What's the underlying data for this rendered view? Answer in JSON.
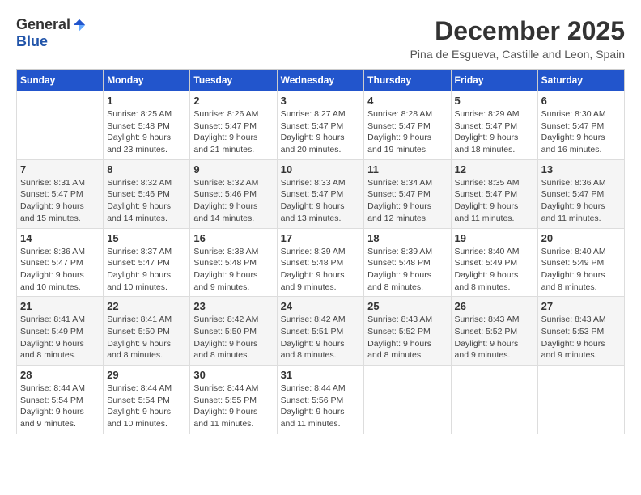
{
  "logo": {
    "general": "General",
    "blue": "Blue"
  },
  "title": "December 2025",
  "subtitle": "Pina de Esgueva, Castille and Leon, Spain",
  "days_of_week": [
    "Sunday",
    "Monday",
    "Tuesday",
    "Wednesday",
    "Thursday",
    "Friday",
    "Saturday"
  ],
  "weeks": [
    [
      {
        "day": "",
        "info": ""
      },
      {
        "day": "1",
        "info": "Sunrise: 8:25 AM\nSunset: 5:48 PM\nDaylight: 9 hours\nand 23 minutes."
      },
      {
        "day": "2",
        "info": "Sunrise: 8:26 AM\nSunset: 5:47 PM\nDaylight: 9 hours\nand 21 minutes."
      },
      {
        "day": "3",
        "info": "Sunrise: 8:27 AM\nSunset: 5:47 PM\nDaylight: 9 hours\nand 20 minutes."
      },
      {
        "day": "4",
        "info": "Sunrise: 8:28 AM\nSunset: 5:47 PM\nDaylight: 9 hours\nand 19 minutes."
      },
      {
        "day": "5",
        "info": "Sunrise: 8:29 AM\nSunset: 5:47 PM\nDaylight: 9 hours\nand 18 minutes."
      },
      {
        "day": "6",
        "info": "Sunrise: 8:30 AM\nSunset: 5:47 PM\nDaylight: 9 hours\nand 16 minutes."
      }
    ],
    [
      {
        "day": "7",
        "info": "Sunrise: 8:31 AM\nSunset: 5:47 PM\nDaylight: 9 hours\nand 15 minutes."
      },
      {
        "day": "8",
        "info": "Sunrise: 8:32 AM\nSunset: 5:46 PM\nDaylight: 9 hours\nand 14 minutes."
      },
      {
        "day": "9",
        "info": "Sunrise: 8:32 AM\nSunset: 5:46 PM\nDaylight: 9 hours\nand 14 minutes."
      },
      {
        "day": "10",
        "info": "Sunrise: 8:33 AM\nSunset: 5:47 PM\nDaylight: 9 hours\nand 13 minutes."
      },
      {
        "day": "11",
        "info": "Sunrise: 8:34 AM\nSunset: 5:47 PM\nDaylight: 9 hours\nand 12 minutes."
      },
      {
        "day": "12",
        "info": "Sunrise: 8:35 AM\nSunset: 5:47 PM\nDaylight: 9 hours\nand 11 minutes."
      },
      {
        "day": "13",
        "info": "Sunrise: 8:36 AM\nSunset: 5:47 PM\nDaylight: 9 hours\nand 11 minutes."
      }
    ],
    [
      {
        "day": "14",
        "info": "Sunrise: 8:36 AM\nSunset: 5:47 PM\nDaylight: 9 hours\nand 10 minutes."
      },
      {
        "day": "15",
        "info": "Sunrise: 8:37 AM\nSunset: 5:47 PM\nDaylight: 9 hours\nand 10 minutes."
      },
      {
        "day": "16",
        "info": "Sunrise: 8:38 AM\nSunset: 5:48 PM\nDaylight: 9 hours\nand 9 minutes."
      },
      {
        "day": "17",
        "info": "Sunrise: 8:39 AM\nSunset: 5:48 PM\nDaylight: 9 hours\nand 9 minutes."
      },
      {
        "day": "18",
        "info": "Sunrise: 8:39 AM\nSunset: 5:48 PM\nDaylight: 9 hours\nand 8 minutes."
      },
      {
        "day": "19",
        "info": "Sunrise: 8:40 AM\nSunset: 5:49 PM\nDaylight: 9 hours\nand 8 minutes."
      },
      {
        "day": "20",
        "info": "Sunrise: 8:40 AM\nSunset: 5:49 PM\nDaylight: 9 hours\nand 8 minutes."
      }
    ],
    [
      {
        "day": "21",
        "info": "Sunrise: 8:41 AM\nSunset: 5:49 PM\nDaylight: 9 hours\nand 8 minutes."
      },
      {
        "day": "22",
        "info": "Sunrise: 8:41 AM\nSunset: 5:50 PM\nDaylight: 9 hours\nand 8 minutes."
      },
      {
        "day": "23",
        "info": "Sunrise: 8:42 AM\nSunset: 5:50 PM\nDaylight: 9 hours\nand 8 minutes."
      },
      {
        "day": "24",
        "info": "Sunrise: 8:42 AM\nSunset: 5:51 PM\nDaylight: 9 hours\nand 8 minutes."
      },
      {
        "day": "25",
        "info": "Sunrise: 8:43 AM\nSunset: 5:52 PM\nDaylight: 9 hours\nand 8 minutes."
      },
      {
        "day": "26",
        "info": "Sunrise: 8:43 AM\nSunset: 5:52 PM\nDaylight: 9 hours\nand 9 minutes."
      },
      {
        "day": "27",
        "info": "Sunrise: 8:43 AM\nSunset: 5:53 PM\nDaylight: 9 hours\nand 9 minutes."
      }
    ],
    [
      {
        "day": "28",
        "info": "Sunrise: 8:44 AM\nSunset: 5:54 PM\nDaylight: 9 hours\nand 9 minutes."
      },
      {
        "day": "29",
        "info": "Sunrise: 8:44 AM\nSunset: 5:54 PM\nDaylight: 9 hours\nand 10 minutes."
      },
      {
        "day": "30",
        "info": "Sunrise: 8:44 AM\nSunset: 5:55 PM\nDaylight: 9 hours\nand 11 minutes."
      },
      {
        "day": "31",
        "info": "Sunrise: 8:44 AM\nSunset: 5:56 PM\nDaylight: 9 hours\nand 11 minutes."
      },
      {
        "day": "",
        "info": ""
      },
      {
        "day": "",
        "info": ""
      },
      {
        "day": "",
        "info": ""
      }
    ]
  ]
}
